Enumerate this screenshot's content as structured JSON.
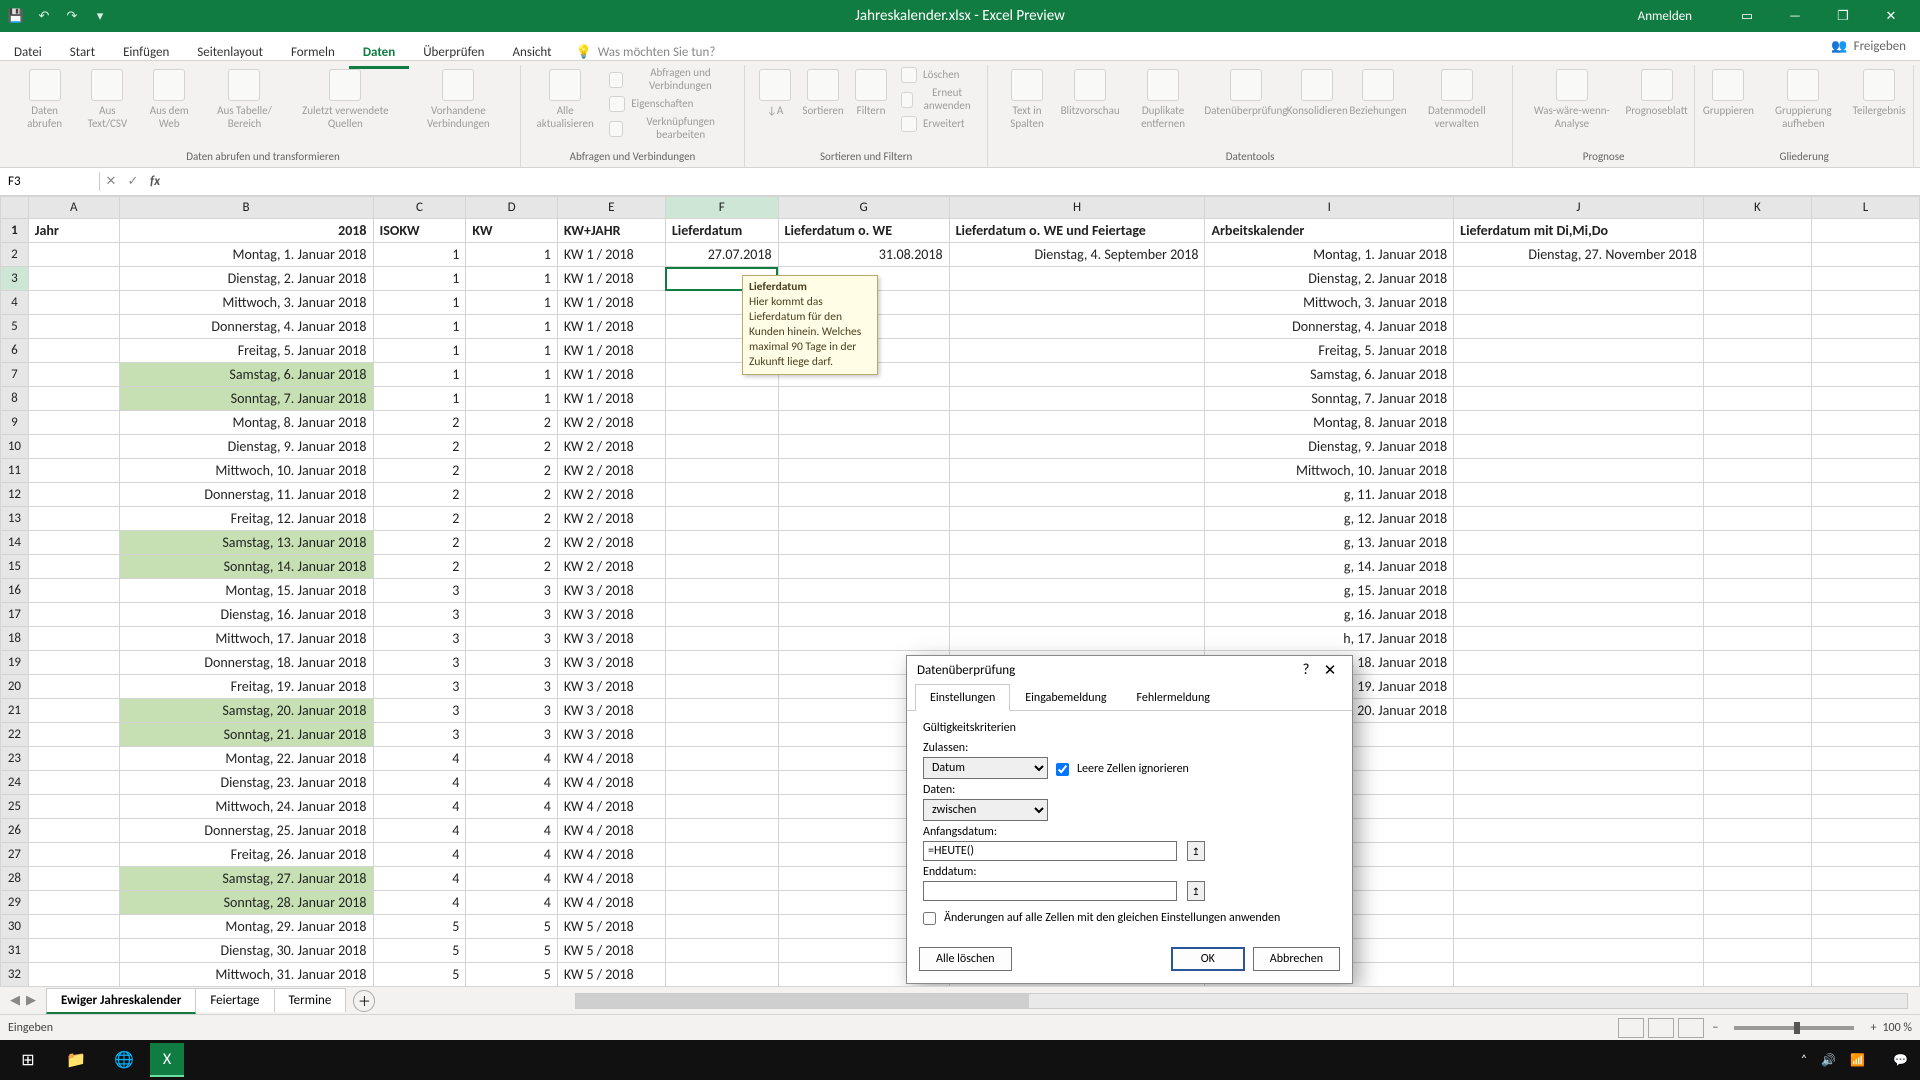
{
  "title": {
    "filename": "Jahreskalender.xlsx - Excel Preview",
    "signin": "Anmelden"
  },
  "menu": {
    "tabs": [
      "Datei",
      "Start",
      "Einfügen",
      "Seitenlayout",
      "Formeln",
      "Daten",
      "Überprüfen",
      "Ansicht"
    ],
    "active_index": 5,
    "tellme": "Was möchten Sie tun?",
    "share": "Freigeben"
  },
  "ribbon": {
    "groups": {
      "get": {
        "name": "Daten abrufen und transformieren",
        "items": [
          "Daten\nabrufen",
          "Aus\nText/CSV",
          "Aus dem\nWeb",
          "Aus Tabelle/\nBereich",
          "Zuletzt verwendete\nQuellen",
          "Vorhandene\nVerbindungen"
        ]
      },
      "queries": {
        "name": "Abfragen und Verbindungen",
        "main": "Alle\naktualisieren",
        "lines": [
          "Abfragen und Verbindungen",
          "Eigenschaften",
          "Verknüpfungen bearbeiten"
        ]
      },
      "sort": {
        "name": "Sortieren und Filtern",
        "sort": "Sortieren",
        "filter": "Filtern",
        "lines": [
          "Löschen",
          "Erneut anwenden",
          "Erweitert"
        ]
      },
      "tools": {
        "name": "Datentools",
        "items": [
          "Text in\nSpalten",
          "Blitzvorschau",
          "Duplikate\nentfernen",
          "Datenüberprüfung",
          "Konsolidieren",
          "Beziehungen",
          "Datenmodell\nverwalten"
        ]
      },
      "forecast": {
        "name": "Prognose",
        "items": [
          "Was-wäre-wenn-\nAnalyse",
          "Prognoseblatt"
        ]
      },
      "outline": {
        "name": "Gliederung",
        "items": [
          "Gruppieren",
          "Gruppierung\naufheben",
          "Teilergebnis"
        ]
      }
    }
  },
  "fbar": {
    "name": "F3",
    "formula": ""
  },
  "grid": {
    "col_letters": [
      "A",
      "B",
      "C",
      "D",
      "E",
      "F",
      "G",
      "H",
      "I",
      "J",
      "K",
      "L"
    ],
    "active_col": 5,
    "active_row": 2,
    "headers": {
      "A": "Jahr",
      "B": "2018",
      "C": "ISOKW",
      "D": "KW",
      "E": "KW+JAHR",
      "F": "Lieferdatum",
      "G": "Lieferdatum o. WE",
      "H": "Lieferdatum o. WE und Feiertage",
      "I": "Arbeitskalender",
      "J": "Lieferdatum mit Di,Mi,Do",
      "K": "",
      "L": ""
    },
    "row2": {
      "F": "27.07.2018",
      "G": "31.08.2018",
      "H": "Dienstag, 4. September 2018",
      "I": "Montag, 1. Januar 2018",
      "J": "Dienstag, 27. November 2018"
    },
    "dayrows": [
      {
        "date": "Montag, 1. Januar 2018",
        "iso": 1,
        "kw": 1,
        "kj": "KW 1 / 2018",
        "cal": "Montag, 1. Januar 2018",
        "we": false
      },
      {
        "date": "Dienstag, 2. Januar 2018",
        "iso": 1,
        "kw": 1,
        "kj": "KW 1 / 2018",
        "cal": "Dienstag, 2. Januar 2018",
        "we": false
      },
      {
        "date": "Mittwoch, 3. Januar 2018",
        "iso": 1,
        "kw": 1,
        "kj": "KW 1 / 2018",
        "cal": "Mittwoch, 3. Januar 2018",
        "we": false
      },
      {
        "date": "Donnerstag, 4. Januar 2018",
        "iso": 1,
        "kw": 1,
        "kj": "KW 1 / 2018",
        "cal": "Donnerstag, 4. Januar 2018",
        "we": false
      },
      {
        "date": "Freitag, 5. Januar 2018",
        "iso": 1,
        "kw": 1,
        "kj": "KW 1 / 2018",
        "cal": "Freitag, 5. Januar 2018",
        "we": false
      },
      {
        "date": "Samstag, 6. Januar 2018",
        "iso": 1,
        "kw": 1,
        "kj": "KW 1 / 2018",
        "cal": "Samstag, 6. Januar 2018",
        "we": true
      },
      {
        "date": "Sonntag, 7. Januar 2018",
        "iso": 1,
        "kw": 1,
        "kj": "KW 1 / 2018",
        "cal": "Sonntag, 7. Januar 2018",
        "we": true
      },
      {
        "date": "Montag, 8. Januar 2018",
        "iso": 2,
        "kw": 2,
        "kj": "KW 2 / 2018",
        "cal": "Montag, 8. Januar 2018",
        "we": false
      },
      {
        "date": "Dienstag, 9. Januar 2018",
        "iso": 2,
        "kw": 2,
        "kj": "KW 2 / 2018",
        "cal": "Dienstag, 9. Januar 2018",
        "we": false
      },
      {
        "date": "Mittwoch, 10. Januar 2018",
        "iso": 2,
        "kw": 2,
        "kj": "KW 2 / 2018",
        "cal": "Mittwoch, 10. Januar 2018",
        "we": false
      },
      {
        "date": "Donnerstag, 11. Januar 2018",
        "iso": 2,
        "kw": 2,
        "kj": "KW 2 / 2018",
        "cal": "g, 11. Januar 2018",
        "we": false
      },
      {
        "date": "Freitag, 12. Januar 2018",
        "iso": 2,
        "kw": 2,
        "kj": "KW 2 / 2018",
        "cal": "g, 12. Januar 2018",
        "we": false
      },
      {
        "date": "Samstag, 13. Januar 2018",
        "iso": 2,
        "kw": 2,
        "kj": "KW 2 / 2018",
        "cal": "g, 13. Januar 2018",
        "we": true
      },
      {
        "date": "Sonntag, 14. Januar 2018",
        "iso": 2,
        "kw": 2,
        "kj": "KW 2 / 2018",
        "cal": "g, 14. Januar 2018",
        "we": true
      },
      {
        "date": "Montag, 15. Januar 2018",
        "iso": 3,
        "kw": 3,
        "kj": "KW 3 / 2018",
        "cal": "g, 15. Januar 2018",
        "we": false
      },
      {
        "date": "Dienstag, 16. Januar 2018",
        "iso": 3,
        "kw": 3,
        "kj": "KW 3 / 2018",
        "cal": "g, 16. Januar 2018",
        "we": false
      },
      {
        "date": "Mittwoch, 17. Januar 2018",
        "iso": 3,
        "kw": 3,
        "kj": "KW 3 / 2018",
        "cal": "h, 17. Januar 2018",
        "we": false
      },
      {
        "date": "Donnerstag, 18. Januar 2018",
        "iso": 3,
        "kw": 3,
        "kj": "KW 3 / 2018",
        "cal": "g, 18. Januar 2018",
        "we": false
      },
      {
        "date": "Freitag, 19. Januar 2018",
        "iso": 3,
        "kw": 3,
        "kj": "KW 3 / 2018",
        "cal": "g, 19. Januar 2018",
        "we": false
      },
      {
        "date": "Samstag, 20. Januar 2018",
        "iso": 3,
        "kw": 3,
        "kj": "KW 3 / 2018",
        "cal": "g, 20. Januar 2018",
        "we": true
      },
      {
        "date": "Sonntag, 21. Januar 2018",
        "iso": 3,
        "kw": 3,
        "kj": "KW 3 / 2018",
        "cal": "",
        "we": true
      },
      {
        "date": "Montag, 22. Januar 2018",
        "iso": 4,
        "kw": 4,
        "kj": "KW 4 / 2018",
        "cal": "",
        "we": false
      },
      {
        "date": "Dienstag, 23. Januar 2018",
        "iso": 4,
        "kw": 4,
        "kj": "KW 4 / 2018",
        "cal": "",
        "we": false
      },
      {
        "date": "Mittwoch, 24. Januar 2018",
        "iso": 4,
        "kw": 4,
        "kj": "KW 4 / 2018",
        "cal": "",
        "we": false
      },
      {
        "date": "Donnerstag, 25. Januar 2018",
        "iso": 4,
        "kw": 4,
        "kj": "KW 4 / 2018",
        "cal": "",
        "we": false
      },
      {
        "date": "Freitag, 26. Januar 2018",
        "iso": 4,
        "kw": 4,
        "kj": "KW 4 / 2018",
        "cal": "",
        "we": false
      },
      {
        "date": "Samstag, 27. Januar 2018",
        "iso": 4,
        "kw": 4,
        "kj": "KW 4 / 2018",
        "cal": "",
        "we": true
      },
      {
        "date": "Sonntag, 28. Januar 2018",
        "iso": 4,
        "kw": 4,
        "kj": "KW 4 / 2018",
        "cal": "",
        "we": true
      },
      {
        "date": "Montag, 29. Januar 2018",
        "iso": 5,
        "kw": 5,
        "kj": "KW 5 / 2018",
        "cal": "",
        "we": false
      },
      {
        "date": "Dienstag, 30. Januar 2018",
        "iso": 5,
        "kw": 5,
        "kj": "KW 5 / 2018",
        "cal": "",
        "we": false
      },
      {
        "date": "Mittwoch, 31. Januar 2018",
        "iso": 5,
        "kw": 5,
        "kj": "KW 5 / 2018",
        "cal": "",
        "we": false
      }
    ]
  },
  "tooltip": {
    "title": "Lieferdatum",
    "body": "Hier kommt das Lieferdatum für den Kunden hinein. Welches maximal 90 Tage in der Zukunft liege darf."
  },
  "dialog": {
    "title": "Datenüberprüfung",
    "tabs": [
      "Einstellungen",
      "Eingabemeldung",
      "Fehlermeldung"
    ],
    "active_tab": 0,
    "criteria_header": "Gültigkeitskriterien",
    "labels": {
      "zulassen": "Zulassen:",
      "daten": "Daten:",
      "anfang": "Anfangsdatum:",
      "ende": "Enddatum:",
      "ignore": "Leere Zellen ignorieren",
      "apply_all": "Änderungen auf alle Zellen mit den gleichen Einstellungen anwenden"
    },
    "values": {
      "zulassen": "Datum",
      "daten": "zwischen",
      "anfang": "=HEUTE()",
      "ende": ""
    },
    "buttons": {
      "clear": "Alle löschen",
      "ok": "OK",
      "cancel": "Abbrechen"
    }
  },
  "sheets": {
    "tabs": [
      "Ewiger Jahreskalender",
      "Feiertage",
      "Termine"
    ],
    "active": 0
  },
  "status": {
    "mode": "Eingeben",
    "zoom": "100 %"
  },
  "taskbar": {
    "time": "",
    "date": ""
  }
}
